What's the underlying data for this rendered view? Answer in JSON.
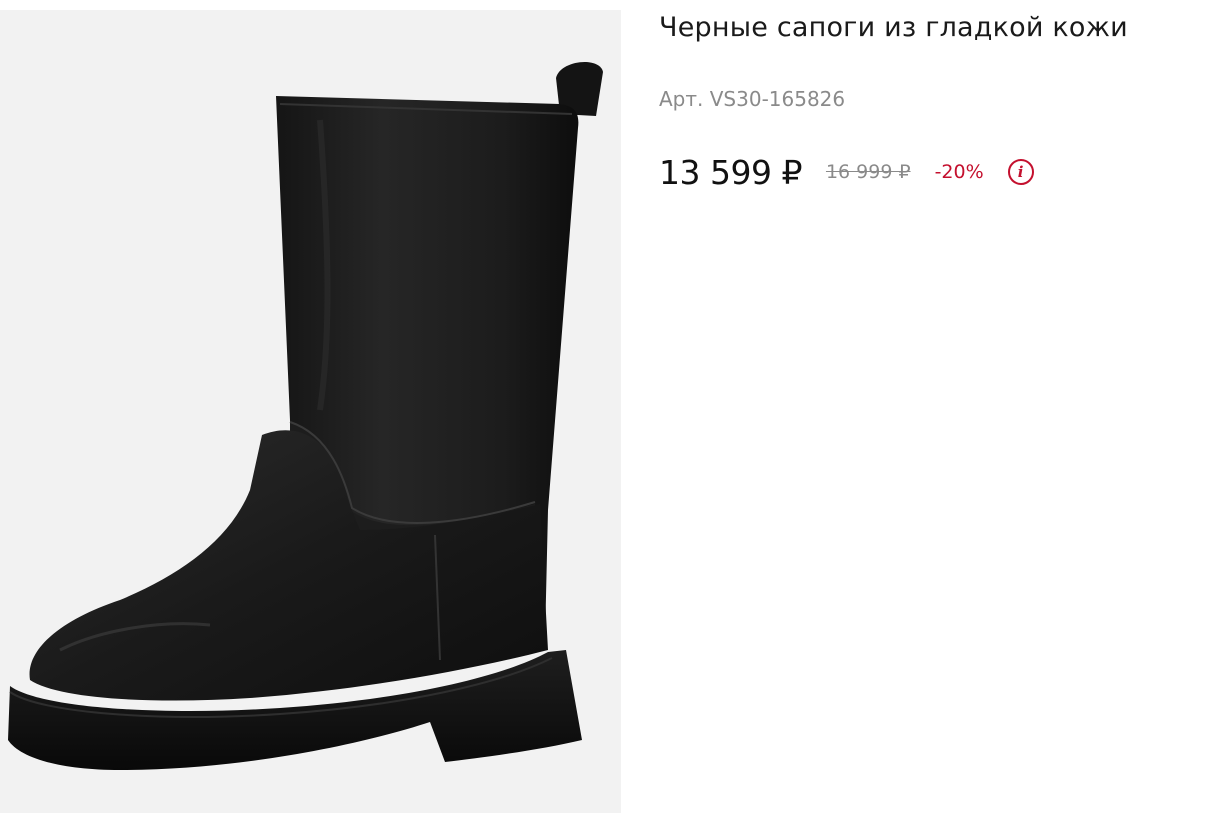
{
  "product": {
    "title": "Черные сапоги из гладкой кожи",
    "article": "Арт. VS30-165826",
    "price_current": "13 599 ₽",
    "price_old": "16 999 ₽",
    "discount": "-20%",
    "info_icon": "i",
    "image_alt": "Черные сапоги из гладкой кожи"
  },
  "colors": {
    "accent": "#c4102e",
    "muted": "#8a8a8a",
    "text": "#111111",
    "image_bg": "#f2f2f2"
  },
  "icons": {
    "info": "info-icon"
  }
}
